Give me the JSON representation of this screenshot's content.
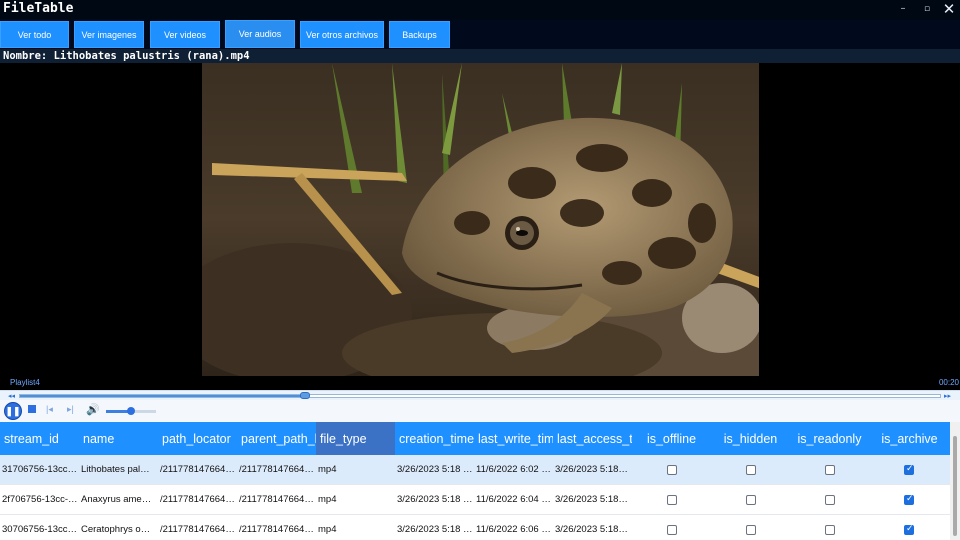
{
  "window": {
    "title": "FileTable",
    "minimize": "–",
    "maximize": "▫",
    "close": "✕"
  },
  "toolbar": {
    "buttons": [
      {
        "label": "Ver todo"
      },
      {
        "label": "Ver imagenes"
      },
      {
        "label": "Ver videos"
      },
      {
        "label": "Ver audios"
      },
      {
        "label": "Ver otros archivos"
      },
      {
        "label": "Backups"
      }
    ],
    "active_index": 3
  },
  "file": {
    "name_label": "Nombre: Lithobates palustris (rana).mp4"
  },
  "player": {
    "playlist": "Playlist4",
    "time": "00:20",
    "progress_fraction": 0.31,
    "volume_fraction": 0.5,
    "icons": {
      "rewind": "◂◂",
      "forward": "▸▸",
      "pause": "❚❚",
      "previous": "|◂",
      "next": "▸|",
      "volume": "🔊"
    }
  },
  "grid": {
    "columns": [
      {
        "label": "stream_id"
      },
      {
        "label": "name"
      },
      {
        "label": "path_locator"
      },
      {
        "label": "parent_path_l"
      },
      {
        "label": "file_type"
      },
      {
        "label": "creation_time"
      },
      {
        "label": "last_write_tim"
      },
      {
        "label": "last_access_ti"
      },
      {
        "label": "is_offline"
      },
      {
        "label": "is_hidden"
      },
      {
        "label": "is_readonly"
      },
      {
        "label": "is_archive"
      }
    ],
    "sorted_column_index": 4,
    "rows": [
      {
        "stream_id": "31706756-13cc-…",
        "name": "Lithobates pal…",
        "path_locator": "/211778147664…",
        "parent_path_locator": "/211778147664…",
        "file_type": "mp4",
        "creation_time": "3/26/2023 5:18 …",
        "last_write_time": "11/6/2022 6:02 …",
        "last_access_time": "3/26/2023 5:18…",
        "is_offline": false,
        "is_hidden": false,
        "is_readonly": false,
        "is_archive": true
      },
      {
        "stream_id": "2f706756-13cc-…",
        "name": "Anaxyrus ame…",
        "path_locator": "/211778147664…",
        "parent_path_locator": "/211778147664…",
        "file_type": "mp4",
        "creation_time": "3/26/2023 5:18 …",
        "last_write_time": "11/6/2022 6:04 …",
        "last_access_time": "3/26/2023 5:18…",
        "is_offline": false,
        "is_hidden": false,
        "is_readonly": false,
        "is_archive": true
      },
      {
        "stream_id": "30706756-13cc…",
        "name": "Ceratophrys o…",
        "path_locator": "/211778147664…",
        "parent_path_locator": "/211778147664…",
        "file_type": "mp4",
        "creation_time": "3/26/2023 5:18 …",
        "last_write_time": "11/6/2022 6:06 …",
        "last_access_time": "3/26/2023 5:18…",
        "is_offline": false,
        "is_hidden": false,
        "is_readonly": false,
        "is_archive": true
      }
    ],
    "selected_row_index": 0
  },
  "colors": {
    "accent": "#1e90ff",
    "selected_header": "#3b72c6",
    "selected_row": "#dcebfc",
    "checkbox_on": "#1d6fe0"
  }
}
